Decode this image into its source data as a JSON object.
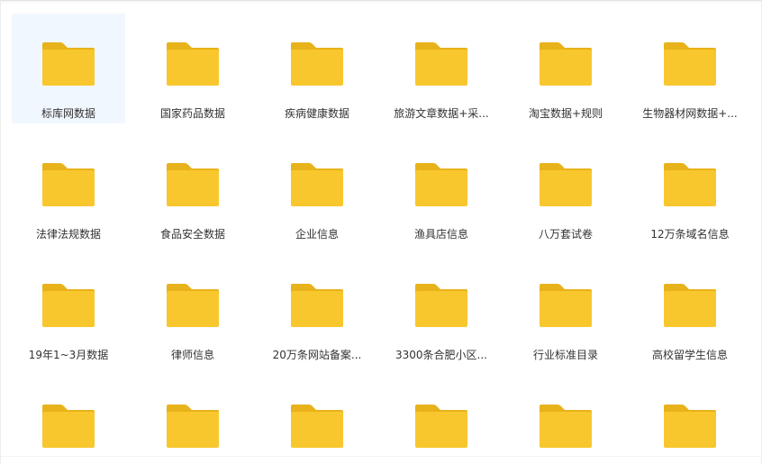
{
  "colors": {
    "folder_tab": "#e8b21a",
    "folder_body": "#f8c72e",
    "selected_bg": "#f1f7fe",
    "label": "#333333"
  },
  "items": [
    {
      "label": "标库网数据",
      "icon": "folder-icon",
      "selected": true
    },
    {
      "label": "国家药品数据",
      "icon": "folder-icon"
    },
    {
      "label": "疾病健康数据",
      "icon": "folder-icon"
    },
    {
      "label": "旅游文章数据+采...",
      "icon": "folder-icon"
    },
    {
      "label": "淘宝数据+规则",
      "icon": "folder-icon"
    },
    {
      "label": "生物器材网数据+...",
      "icon": "folder-icon"
    },
    {
      "label": "法律法规数据",
      "icon": "folder-icon"
    },
    {
      "label": "食品安全数据",
      "icon": "folder-icon"
    },
    {
      "label": "企业信息",
      "icon": "folder-icon"
    },
    {
      "label": "渔具店信息",
      "icon": "folder-icon"
    },
    {
      "label": "八万套试卷",
      "icon": "folder-icon"
    },
    {
      "label": "12万条域名信息",
      "icon": "folder-icon"
    },
    {
      "label": "19年1~3月数据",
      "icon": "folder-icon"
    },
    {
      "label": "律师信息",
      "icon": "folder-icon"
    },
    {
      "label": "20万条网站备案...",
      "icon": "folder-icon"
    },
    {
      "label": "3300条合肥小区...",
      "icon": "folder-icon"
    },
    {
      "label": "行业标准目录",
      "icon": "folder-icon"
    },
    {
      "label": "高校留学生信息",
      "icon": "folder-icon"
    },
    {
      "label": "",
      "icon": "folder-icon"
    },
    {
      "label": "",
      "icon": "folder-icon"
    },
    {
      "label": "",
      "icon": "folder-icon"
    },
    {
      "label": "",
      "icon": "folder-icon"
    },
    {
      "label": "",
      "icon": "folder-icon"
    },
    {
      "label": "",
      "icon": "folder-icon"
    }
  ]
}
